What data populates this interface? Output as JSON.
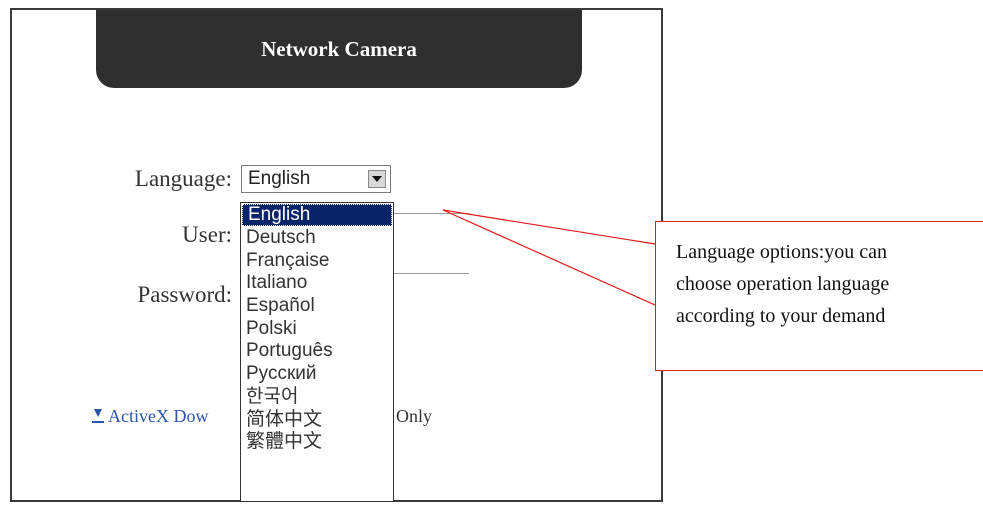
{
  "header": {
    "title": "Network Camera"
  },
  "form": {
    "language_label": "Language:",
    "language_selected": "English",
    "user_label": "User:",
    "password_label": "Password:"
  },
  "language_options": [
    "English",
    "Deutsch",
    "Française",
    "Italiano",
    "Español",
    "Polski",
    "Português",
    "Русский",
    "한국어",
    "简体中文",
    "繁體中文"
  ],
  "activex": {
    "link_text": "ActiveX Dow",
    "trailing_text": "xplorer Only"
  },
  "callout": {
    "line1": "Language options:you can",
    "line2": "choose operation language",
    "line3": "according to your demand"
  },
  "colors": {
    "header_bg": "#2f2f2f",
    "selection_bg": "#0a246a",
    "callout_border": "#e01818",
    "link": "#2a55a8"
  }
}
